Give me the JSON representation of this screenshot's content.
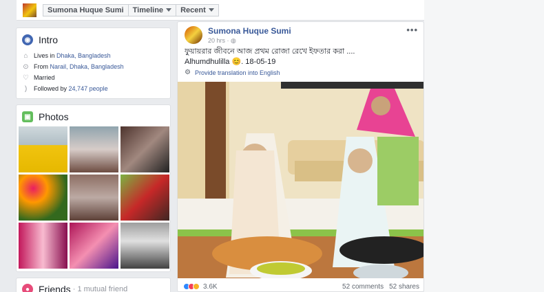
{
  "header": {
    "profile_name": "Sumona Huque Sumi",
    "timeline_label": "Timeline",
    "recent_label": "Recent"
  },
  "intro": {
    "title": "Intro",
    "lives_prefix": "Lives in ",
    "lives_place": "Dhaka, Bangladesh",
    "from_prefix": "From ",
    "from_place": "Narail, Dhaka, Bangladesh",
    "relationship": "Married",
    "followed_prefix": "Followed by ",
    "followed_count": "24,747 people"
  },
  "photos": {
    "title": "Photos"
  },
  "friends": {
    "title": "Friends",
    "mutual": " · 1 mutual friend"
  },
  "post": {
    "author": "Sumona Huque Sumi",
    "time": "20 hrs · ",
    "text_line1": "ফুয়ায়রার জীবনে আজ প্রথম রোজা রেখে ইফতার করা ....",
    "text_line2": "Alhumdhulilla 😊. 18-05-19",
    "translate": "Provide translation into English",
    "reaction_count": "3.6K",
    "comments": "52 comments",
    "shares": "52 shares"
  },
  "colors": {
    "link": "#385898",
    "intro_icon": "#4267b2",
    "photos_icon": "#63be5d",
    "friends_icon": "#e74c7a"
  }
}
